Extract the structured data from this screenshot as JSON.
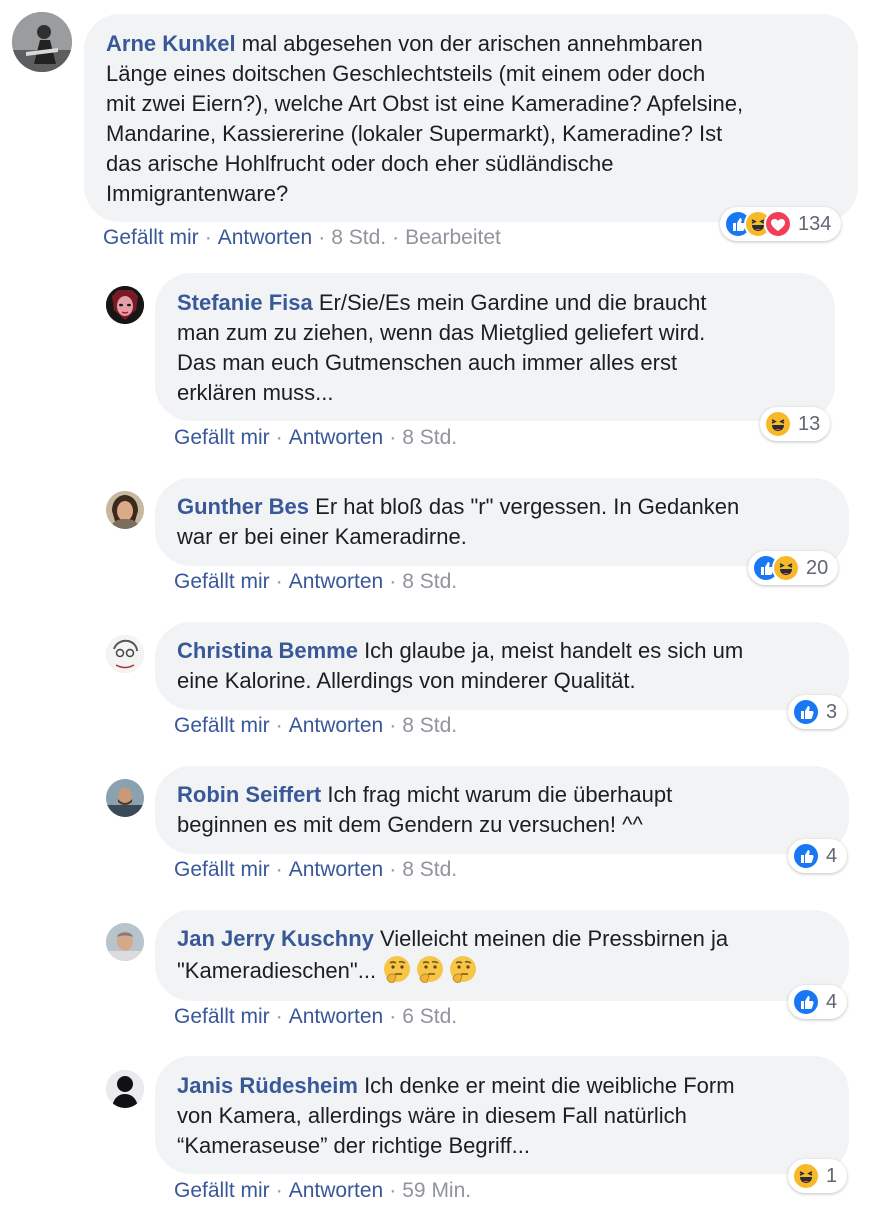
{
  "comments": [
    {
      "author": "Arne Kunkel",
      "lines": [
        " mal abgesehen von der arischen annehmbaren",
        "Länge eines doitschen Geschlechtsteils (mit einem oder doch",
        "mit zwei Eiern?), welche Art Obst ist eine Kameradine? Apfelsine,",
        "Mandarine, Kassiererine (lokaler Supermarkt), Kameradine? Ist",
        "das arische Hohlfrucht oder doch eher südländische",
        "Immigrantenware?"
      ],
      "like": "Gefällt mir",
      "reply": "Antworten",
      "time": "8 Std.",
      "edited": "Bearbeitet",
      "reactions": [
        "like",
        "haha",
        "love"
      ],
      "reaction_count": "134"
    },
    {
      "author": "Stefanie Fisa",
      "lines": [
        " Er/Sie/Es mein Gardine und die braucht",
        "man zum zu ziehen, wenn das Mietglied geliefert wird.",
        "Das man euch Gutmenschen auch immer alles erst",
        "erklären muss..."
      ],
      "like": "Gefällt mir",
      "reply": "Antworten",
      "time": "8 Std.",
      "reactions": [
        "haha"
      ],
      "reaction_count": "13"
    },
    {
      "author": "Gunther Bes",
      "lines": [
        " Er hat bloß das \"r\" vergessen. In Gedanken",
        "war er bei einer Kameradirne."
      ],
      "like": "Gefällt mir",
      "reply": "Antworten",
      "time": "8 Std.",
      "reactions": [
        "like",
        "haha"
      ],
      "reaction_count": "20"
    },
    {
      "author": "Christina Bemme",
      "lines": [
        " Ich glaube ja, meist handelt es sich um",
        "eine Kalorine. Allerdings von minderer Qualität."
      ],
      "like": "Gefällt mir",
      "reply": "Antworten",
      "time": "8 Std.",
      "reactions": [
        "like"
      ],
      "reaction_count": "3"
    },
    {
      "author": "Robin Seiffert",
      "lines": [
        " Ich frag micht warum die überhaupt",
        "beginnen es mit dem Gendern zu versuchen! ^^"
      ],
      "like": "Gefällt mir",
      "reply": "Antworten",
      "time": "8 Std.",
      "reactions": [
        "like"
      ],
      "reaction_count": "4"
    },
    {
      "author": "Jan Jerry Kuschny",
      "lines": [
        " Vielleicht meinen die Pressbirnen ja",
        "\"Kameradieschen\"... "
      ],
      "inline_emojis": [
        "thinking-face",
        "thinking-face",
        "thinking-face"
      ],
      "like": "Gefällt mir",
      "reply": "Antworten",
      "time": "6 Std.",
      "reactions": [
        "like"
      ],
      "reaction_count": "4"
    },
    {
      "author": "Janis Rüdesheim",
      "lines": [
        " Ich denke er meint die weibliche Form",
        "von Kamera, allerdings wäre in diesem Fall natürlich",
        "“Kameraseuse” der richtige Begriff..."
      ],
      "like": "Gefällt mir",
      "reply": "Antworten",
      "time": "59 Min.",
      "reactions": [
        "haha"
      ],
      "reaction_count": "1"
    }
  ],
  "colors": {
    "author": "#385898",
    "bubble": "#f2f3f5",
    "meta": "#90949c",
    "like_blue": "#1877f2",
    "love_red": "#f33e58",
    "haha_yellow": "#f7b928"
  }
}
